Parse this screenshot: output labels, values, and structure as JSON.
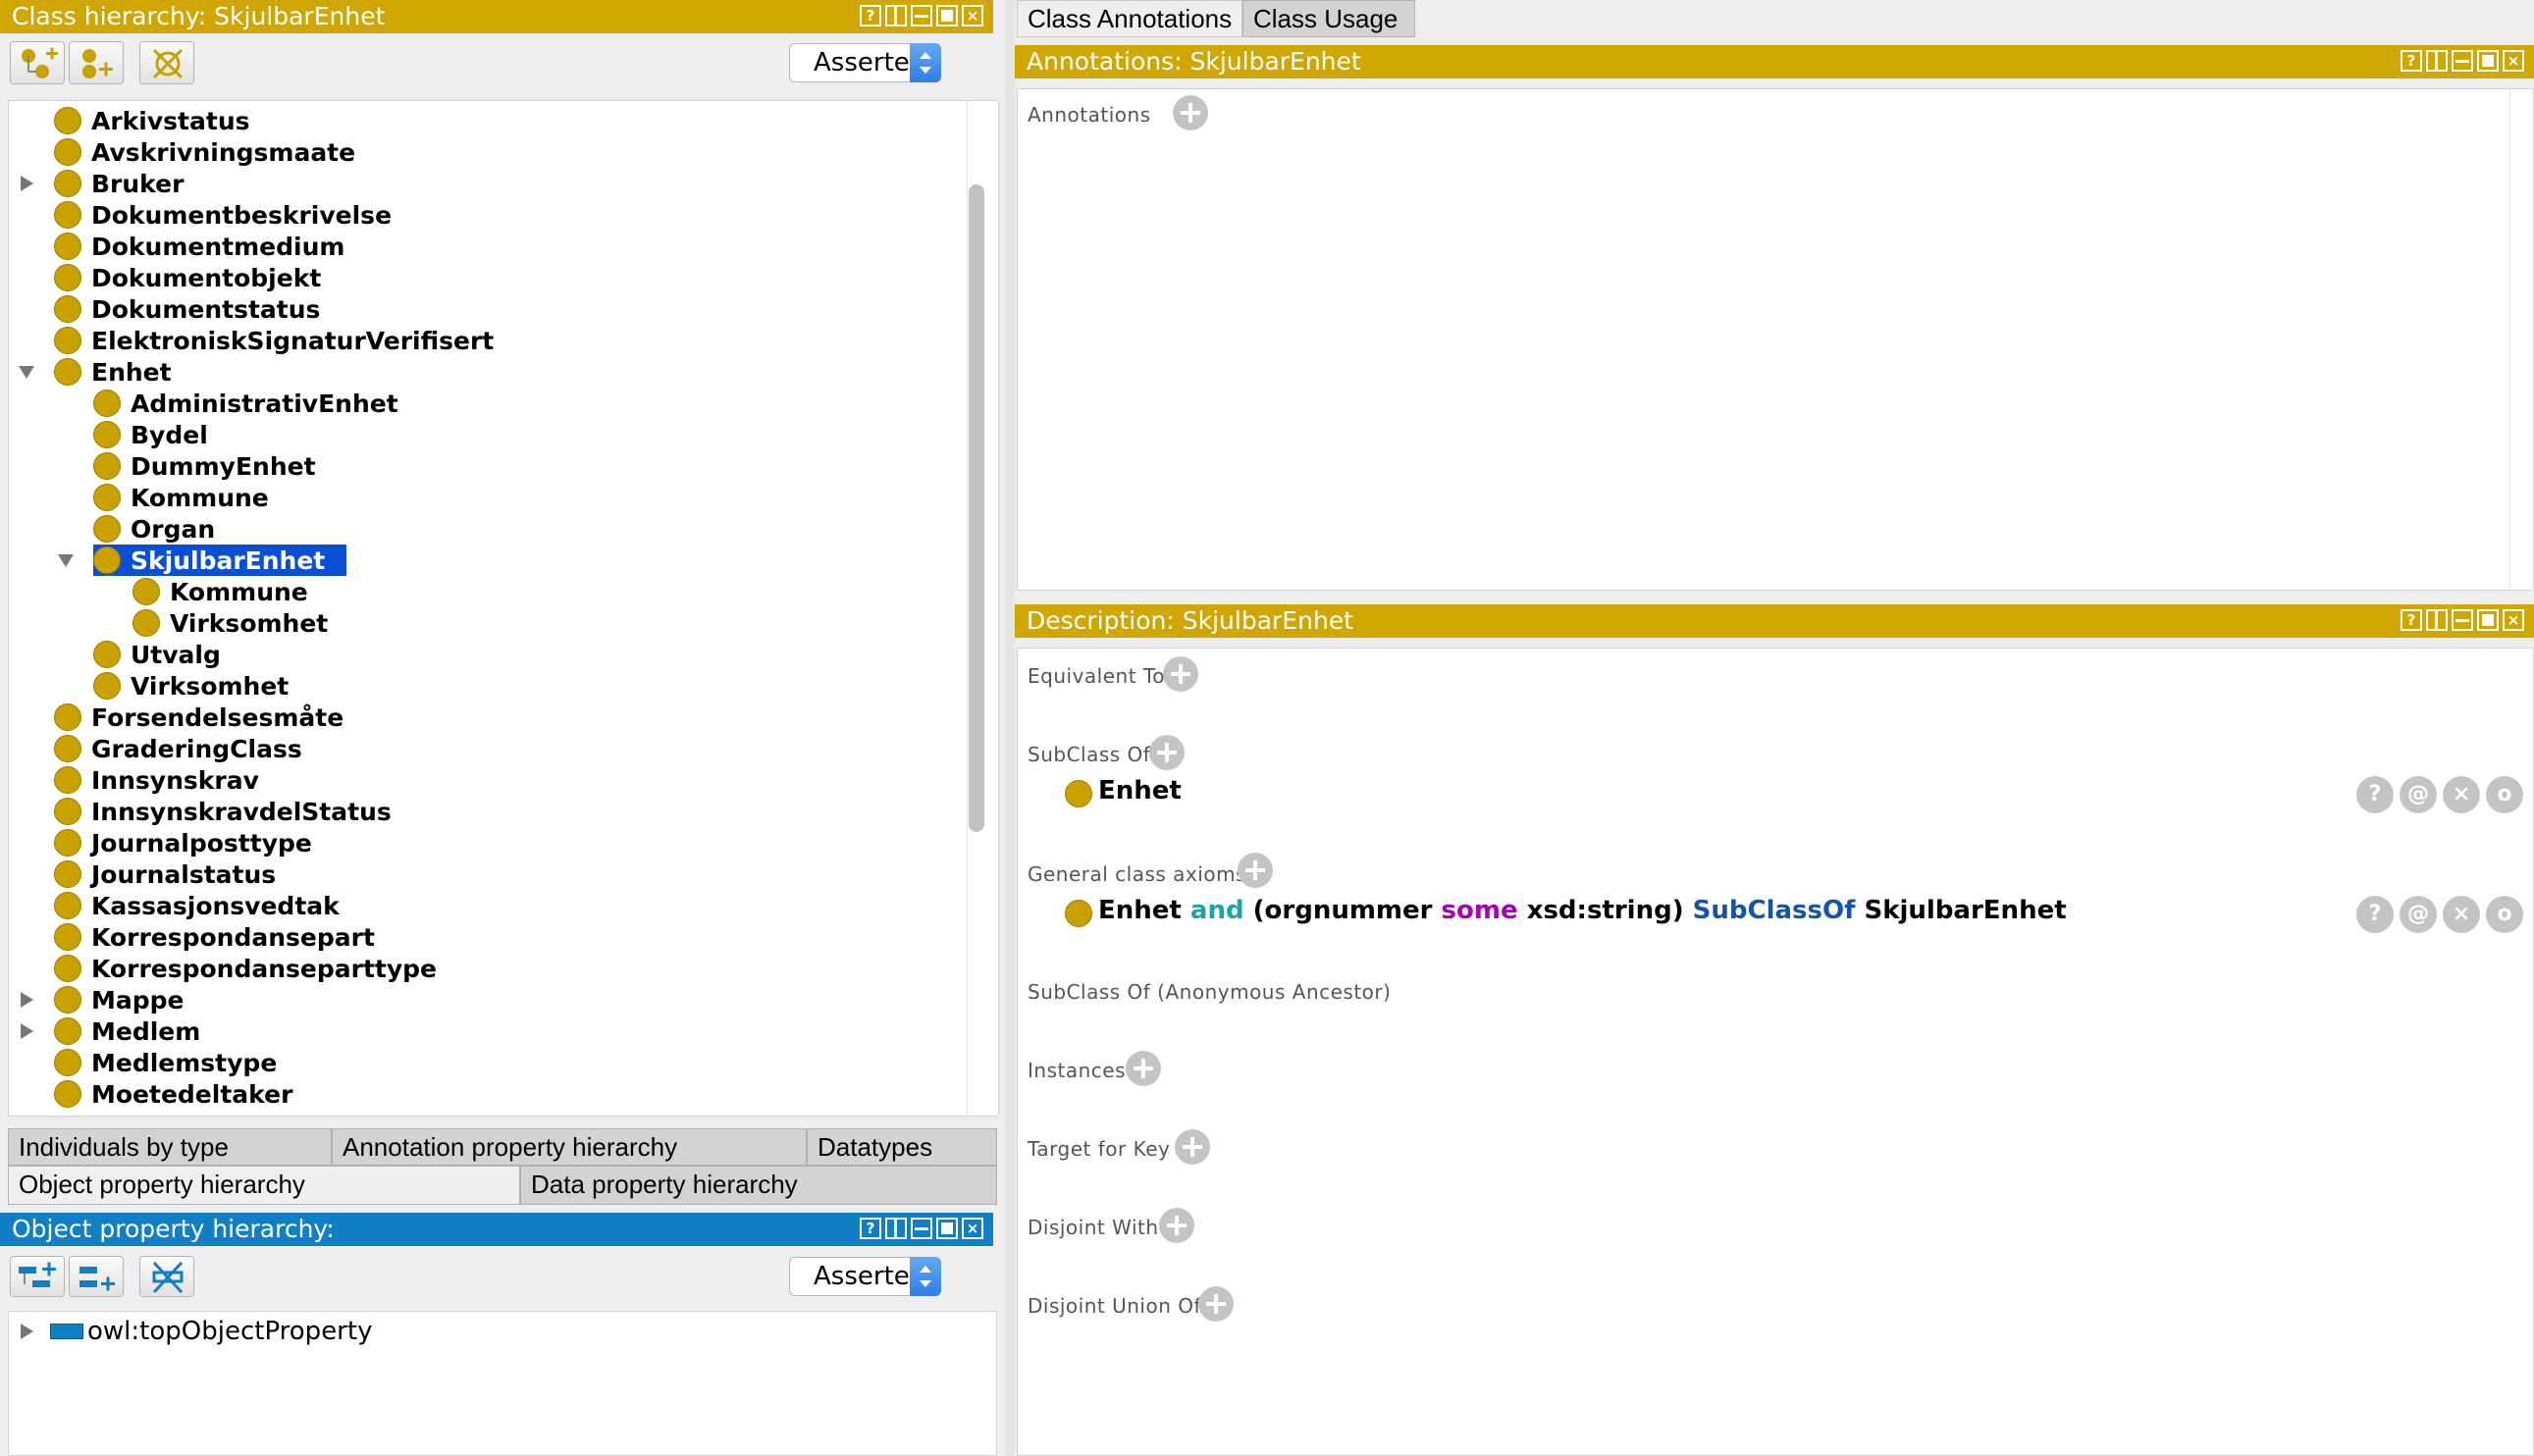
{
  "class_hierarchy": {
    "title": "Class hierarchy: SkjulbarEnhet",
    "mode": "Asserted",
    "tree": [
      {
        "label": "Arkivstatus",
        "depth": 0,
        "expander": "none",
        "selected": false
      },
      {
        "label": "Avskrivningsmaate",
        "depth": 0,
        "expander": "none",
        "selected": false
      },
      {
        "label": "Bruker",
        "depth": 0,
        "expander": "collapsed",
        "selected": false
      },
      {
        "label": "Dokumentbeskrivelse",
        "depth": 0,
        "expander": "none",
        "selected": false
      },
      {
        "label": "Dokumentmedium",
        "depth": 0,
        "expander": "none",
        "selected": false
      },
      {
        "label": "Dokumentobjekt",
        "depth": 0,
        "expander": "none",
        "selected": false
      },
      {
        "label": "Dokumentstatus",
        "depth": 0,
        "expander": "none",
        "selected": false
      },
      {
        "label": "ElektroniskSignaturVerifisert",
        "depth": 0,
        "expander": "none",
        "selected": false
      },
      {
        "label": "Enhet",
        "depth": 0,
        "expander": "expanded",
        "selected": false
      },
      {
        "label": "AdministrativEnhet",
        "depth": 1,
        "expander": "none",
        "selected": false
      },
      {
        "label": "Bydel",
        "depth": 1,
        "expander": "none",
        "selected": false
      },
      {
        "label": "DummyEnhet",
        "depth": 1,
        "expander": "none",
        "selected": false
      },
      {
        "label": "Kommune",
        "depth": 1,
        "expander": "none",
        "selected": false
      },
      {
        "label": "Organ",
        "depth": 1,
        "expander": "none",
        "selected": false
      },
      {
        "label": "SkjulbarEnhet",
        "depth": 1,
        "expander": "expanded",
        "selected": true
      },
      {
        "label": "Kommune",
        "depth": 2,
        "expander": "none",
        "selected": false
      },
      {
        "label": "Virksomhet",
        "depth": 2,
        "expander": "none",
        "selected": false
      },
      {
        "label": "Utvalg",
        "depth": 1,
        "expander": "none",
        "selected": false
      },
      {
        "label": "Virksomhet",
        "depth": 1,
        "expander": "none",
        "selected": false
      },
      {
        "label": "Forsendelsesmåte",
        "depth": 0,
        "expander": "none",
        "selected": false
      },
      {
        "label": "GraderingClass",
        "depth": 0,
        "expander": "none",
        "selected": false
      },
      {
        "label": "Innsynskrav",
        "depth": 0,
        "expander": "none",
        "selected": false
      },
      {
        "label": "InnsynskravdelStatus",
        "depth": 0,
        "expander": "none",
        "selected": false
      },
      {
        "label": "Journalposttype",
        "depth": 0,
        "expander": "none",
        "selected": false
      },
      {
        "label": "Journalstatus",
        "depth": 0,
        "expander": "none",
        "selected": false
      },
      {
        "label": "Kassasjonsvedtak",
        "depth": 0,
        "expander": "none",
        "selected": false
      },
      {
        "label": "Korrespondansepart",
        "depth": 0,
        "expander": "none",
        "selected": false
      },
      {
        "label": "Korrespondanseparttype",
        "depth": 0,
        "expander": "none",
        "selected": false
      },
      {
        "label": "Mappe",
        "depth": 0,
        "expander": "collapsed",
        "selected": false
      },
      {
        "label": "Medlem",
        "depth": 0,
        "expander": "collapsed",
        "selected": false
      },
      {
        "label": "Medlemstype",
        "depth": 0,
        "expander": "none",
        "selected": false
      },
      {
        "label": "Moetedeltaker",
        "depth": 0,
        "expander": "none",
        "selected": false
      }
    ]
  },
  "bottom_tabs": {
    "row1": [
      "Individuals by type",
      "Annotation property hierarchy",
      "Datatypes"
    ],
    "row2": [
      "Object property hierarchy",
      "Data property hierarchy"
    ]
  },
  "object_property_hierarchy": {
    "title": "Object property hierarchy:",
    "mode": "Asserted",
    "root": "owl:topObjectProperty"
  },
  "right_tabs": [
    "Class Annotations",
    "Class Usage"
  ],
  "annotations": {
    "title": "Annotations: SkjulbarEnhet",
    "label": "Annotations"
  },
  "description": {
    "title": "Description: SkjulbarEnhet",
    "equivalent_to": "Equivalent To",
    "subclass_of": "SubClass Of",
    "subclass_value": "Enhet",
    "general_axioms": "General class axioms",
    "axiom": {
      "class1": "Enhet",
      "and": "and",
      "open": "(orgnummer",
      "some": "some",
      "datatype": "xsd:string)",
      "subclassof": "SubClassOf",
      "class2": "SkjulbarEnhet"
    },
    "anonymous_ancestor": "SubClass Of (Anonymous Ancestor)",
    "instances": "Instances",
    "target_for_key": "Target for Key",
    "disjoint_with": "Disjoint With",
    "disjoint_union_of": "Disjoint Union Of"
  },
  "frame_buttons": {
    "help": "?",
    "annotate": "@",
    "delete": "×",
    "edit": "o"
  },
  "colors": {
    "class_yellow": "#d0a600",
    "property_blue": "#117fc4",
    "selection": "#0a4fd6",
    "keyword_and": "#1aa3a8",
    "keyword_some": "#a600b8",
    "keyword_subclassof": "#1254a9"
  }
}
